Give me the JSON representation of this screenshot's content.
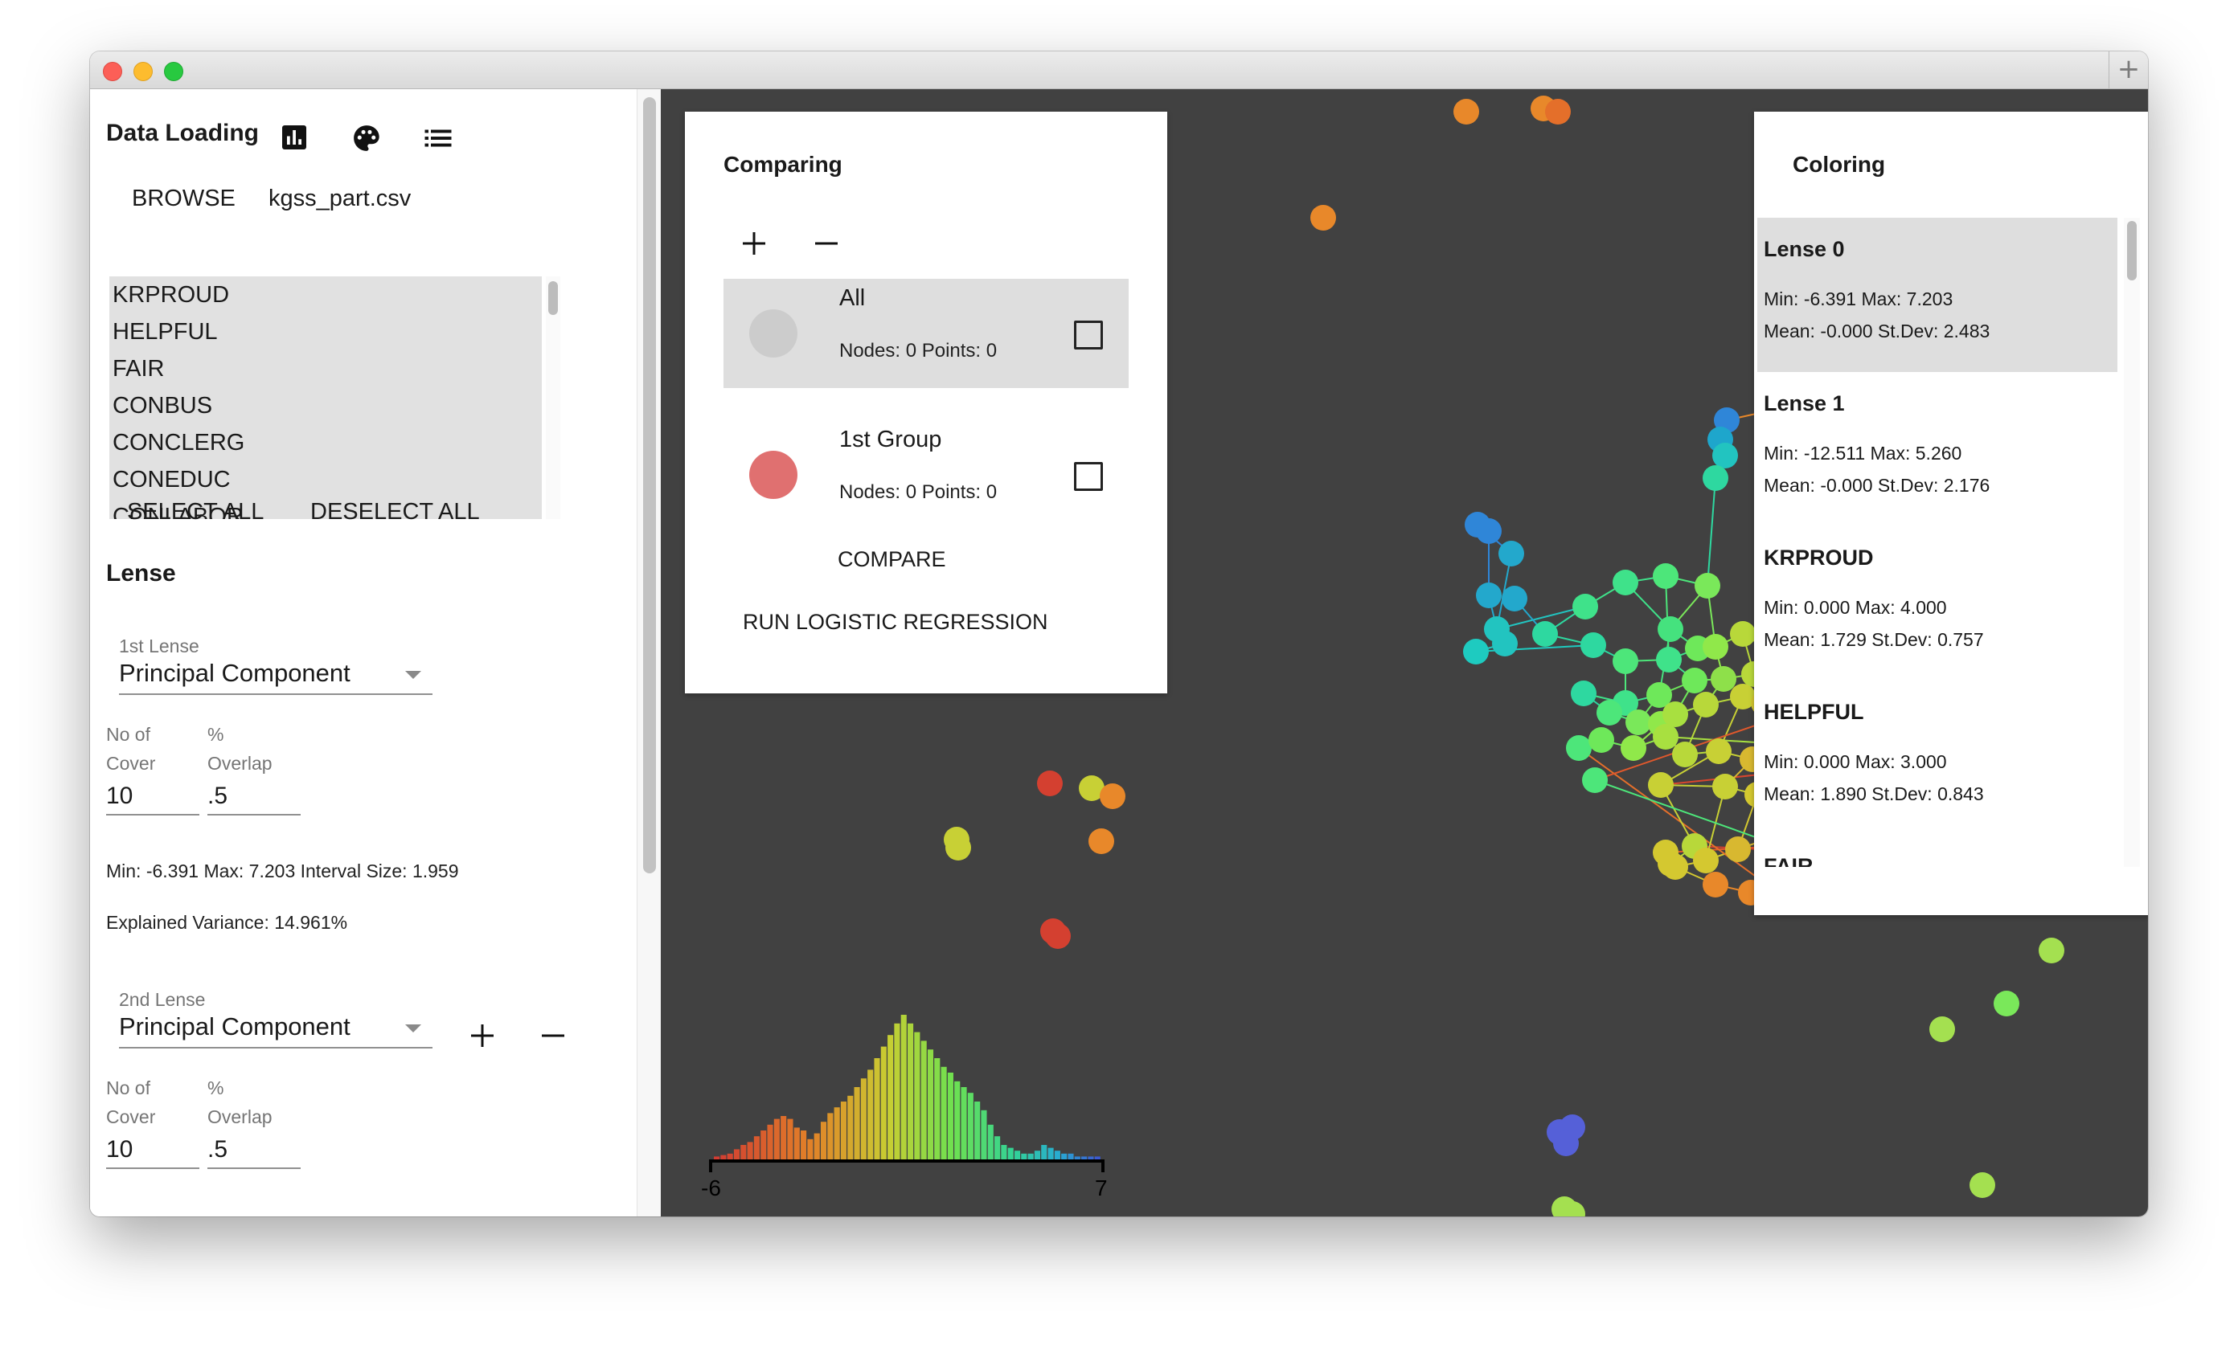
{
  "sidebar": {
    "title": "Data Loading",
    "icons": [
      "bar-chart-icon",
      "palette-icon",
      "list-icon"
    ],
    "browse_label": "BROWSE",
    "file_name": "kgss_part.csv",
    "variables": [
      "KRPROUD",
      "HELPFUL",
      "FAIR",
      "CONBUS",
      "CONCLERG",
      "CONEDUC",
      "CONLABOR"
    ],
    "select_all_label": "SELECT ALL",
    "deselect_all_label": "DESELECT ALL",
    "lense_heading": "Lense",
    "lense1": {
      "label": "1st Lense",
      "value": "Principal Component",
      "cover_label_1": "No of",
      "cover_label_2": "Cover",
      "overlap_label_1": "%",
      "overlap_label_2": "Overlap",
      "cover_value": "10",
      "overlap_value": ".5",
      "stats": "Min: -6.391 Max: 7.203 Interval Size: 1.959",
      "variance": "Explained Variance: 14.961%"
    },
    "lense2": {
      "label": "2nd Lense",
      "value": "Principal Component",
      "cover_label_1": "No of",
      "cover_label_2": "Cover",
      "overlap_label_1": "%",
      "overlap_label_2": "Overlap",
      "cover_value": "10",
      "overlap_value": ".5"
    }
  },
  "comparing": {
    "title": "Comparing",
    "groups": [
      {
        "name": "All",
        "info": "Nodes: 0 Points: 0",
        "color": "#cccccc"
      },
      {
        "name": "1st Group",
        "info": "Nodes: 0 Points: 0",
        "color": "#e07070"
      }
    ],
    "compare_label": "COMPARE",
    "regression_label": "RUN LOGISTIC REGRESSION"
  },
  "coloring": {
    "title": "Coloring",
    "items": [
      {
        "name": "Lense 0",
        "line1": "Min: -6.391 Max: 7.203",
        "line2": "Mean: -0.000 St.Dev: 2.483"
      },
      {
        "name": "Lense 1",
        "line1": "Min: -12.511 Max: 5.260",
        "line2": "Mean: -0.000 St.Dev: 2.176"
      },
      {
        "name": "KRPROUD",
        "line1": "Min: 0.000 Max: 4.000",
        "line2": "Mean: 1.729 St.Dev: 0.757"
      },
      {
        "name": "HELPFUL",
        "line1": "Min: 0.000 Max: 3.000",
        "line2": "Mean: 1.890 St.Dev: 0.843"
      },
      {
        "name": "FAIR",
        "line1": "",
        "line2": ""
      }
    ]
  },
  "histogram": {
    "min_label": "-6",
    "max_label": "7",
    "values": [
      2,
      3,
      4,
      7,
      10,
      12,
      16,
      20,
      24,
      28,
      30,
      28,
      22,
      20,
      14,
      18,
      26,
      32,
      36,
      40,
      44,
      50,
      56,
      62,
      70,
      78,
      86,
      94,
      100,
      94,
      88,
      82,
      76,
      70,
      64,
      60,
      54,
      50,
      46,
      40,
      34,
      24,
      16,
      10,
      8,
      6,
      4,
      4,
      6,
      10,
      8,
      6,
      4,
      4,
      2,
      2,
      2,
      2
    ]
  },
  "colors": {
    "canvas_bg": "#414141",
    "edge": "#b3a85a",
    "selected_row": "#dedede"
  }
}
